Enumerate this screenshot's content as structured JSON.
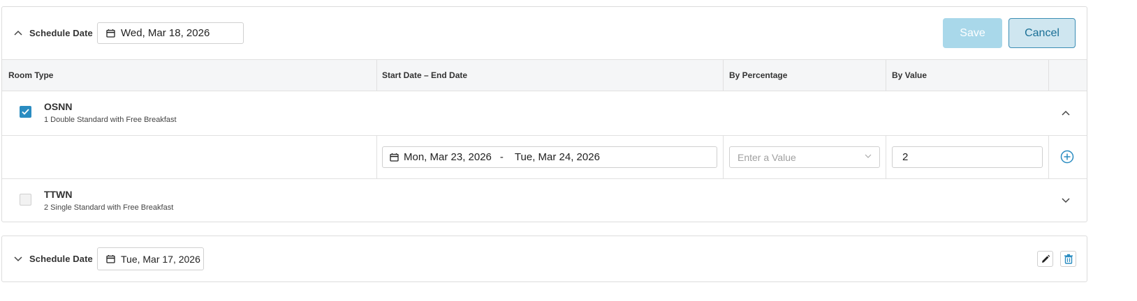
{
  "schedules": [
    {
      "label": "Schedule Date",
      "date": "Wed, Mar 18, 2026",
      "expanded": true,
      "actions": {
        "save": "Save",
        "cancel": "Cancel"
      },
      "columns": [
        "Room Type",
        "Start Date – End Date",
        "By Percentage",
        "By Value"
      ],
      "room_types": [
        {
          "code": "OSNN",
          "description": "1 Double Standard with Free Breakfast",
          "checked": true,
          "expanded": true,
          "rule": {
            "start_date": "Mon, Mar 23, 2026",
            "separator": "-",
            "end_date": "Tue, Mar 24, 2026",
            "percentage_placeholder": "Enter a Value",
            "value": "2"
          }
        },
        {
          "code": "TTWN",
          "description": "2 Single Standard with Free Breakfast",
          "checked": false,
          "expanded": false
        }
      ]
    },
    {
      "label": "Schedule Date",
      "date": "Tue, Mar 17, 2026",
      "expanded": false
    }
  ],
  "colors": {
    "accent": "#2a8cc1",
    "save_bg": "#a9d8ea",
    "cancel_bg": "#cfe6f0",
    "cancel_text": "#1a6f96"
  },
  "icons": [
    "chevron-up-icon",
    "calendar-icon",
    "check-icon",
    "chevron-down-icon",
    "plus-circle-icon",
    "pencil-icon",
    "trash-icon"
  ]
}
